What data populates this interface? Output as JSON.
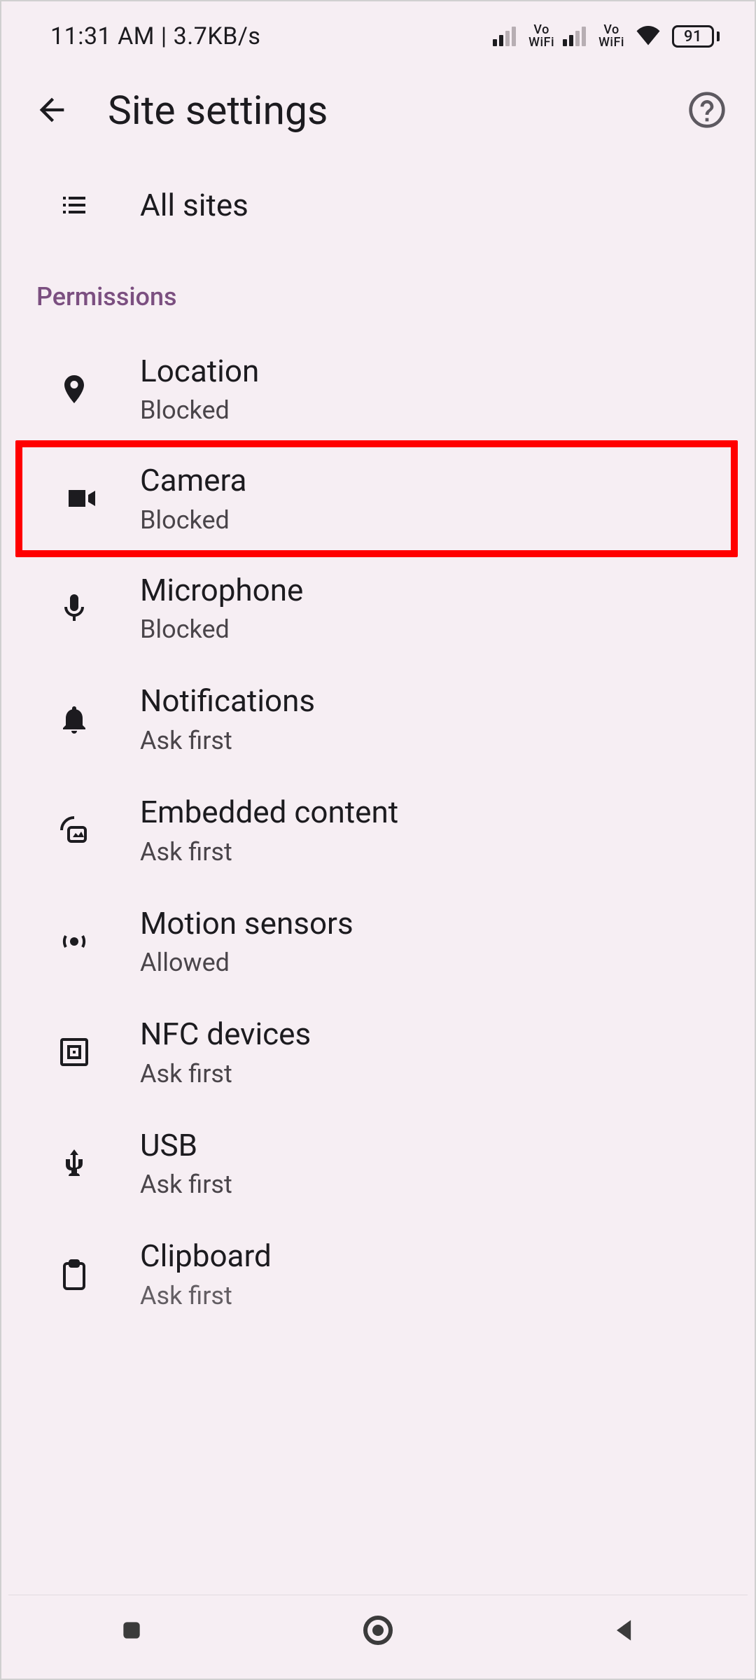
{
  "status": {
    "time": "11:31 AM",
    "netspeed": "3.7KB/s",
    "vowifi_top": "Vo",
    "vowifi_bottom": "WiFi",
    "battery": "91"
  },
  "header": {
    "title": "Site settings"
  },
  "allSites": {
    "label": "All sites"
  },
  "section": {
    "title": "Permissions"
  },
  "items": {
    "location": {
      "title": "Location",
      "sub": "Blocked"
    },
    "camera": {
      "title": "Camera",
      "sub": "Blocked"
    },
    "microphone": {
      "title": "Microphone",
      "sub": "Blocked"
    },
    "notifications": {
      "title": "Notifications",
      "sub": "Ask first"
    },
    "embedded": {
      "title": "Embedded content",
      "sub": "Ask first"
    },
    "motion": {
      "title": "Motion sensors",
      "sub": "Allowed"
    },
    "nfc": {
      "title": "NFC devices",
      "sub": "Ask first"
    },
    "usb": {
      "title": "USB",
      "sub": "Ask first"
    },
    "clipboard": {
      "title": "Clipboard",
      "sub": "Ask first"
    }
  }
}
